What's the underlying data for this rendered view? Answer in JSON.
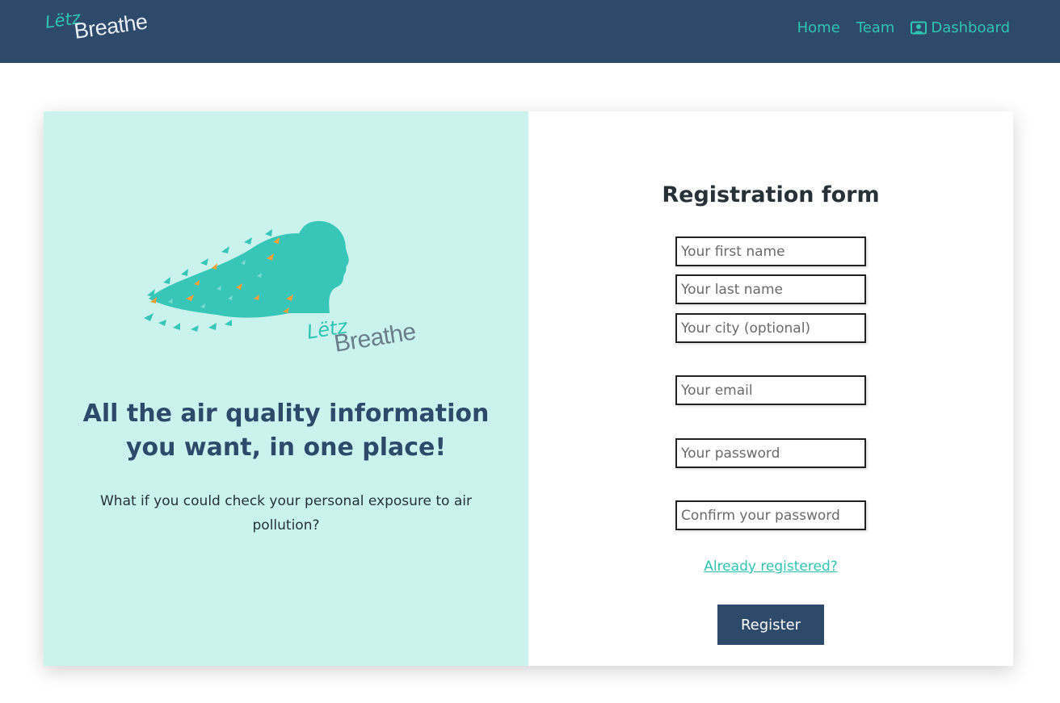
{
  "nav": {
    "logo": {
      "letz": "Lëtz",
      "breathe": "Breathe"
    },
    "links": {
      "home": "Home",
      "team": "Team",
      "dashboard": "Dashboard"
    }
  },
  "hero": {
    "logo": {
      "letz": "Lëtz",
      "breathe": "Breathe"
    },
    "headline": "All the air quality information you want, in one place!",
    "subtext": "What if you could check your personal exposure to air pollution?"
  },
  "form": {
    "title": "Registration form",
    "fields": {
      "first_name": {
        "placeholder": "Your first name",
        "value": ""
      },
      "last_name": {
        "placeholder": "Your last name",
        "value": ""
      },
      "city": {
        "placeholder": "Your city (optional)",
        "value": ""
      },
      "email": {
        "placeholder": "Your email",
        "value": ""
      },
      "password": {
        "placeholder": "Your password",
        "value": ""
      },
      "confirm_password": {
        "placeholder": "Confirm your password",
        "value": ""
      }
    },
    "already_registered": "Already registered?",
    "register_label": "Register"
  },
  "colors": {
    "navbar": "#2e4a6b",
    "accent": "#2fc4b2",
    "hero_background": "#cbf3ee",
    "button": "#2e4a6b",
    "butterfly_orange": "#f5a03c"
  },
  "icons": {
    "dashboard": "user-dashboard-icon",
    "hero": "woman-silhouette-with-butterflies"
  }
}
